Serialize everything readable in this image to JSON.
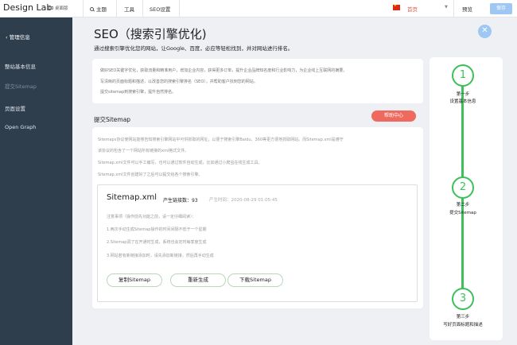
{
  "topbar": {
    "logo": "Design Lab",
    "logo_sub": "桌面版",
    "nav": [
      {
        "label": "主题",
        "icon": "search-icon"
      },
      {
        "label": "工具"
      },
      {
        "label": "SEO设置"
      }
    ],
    "page_select": "首页",
    "preview": "预览",
    "save": "保存"
  },
  "sidebar": {
    "back_label": "管理信息",
    "items": [
      {
        "label": "整站基本信息",
        "active": false
      },
      {
        "label": "提交Sitemap",
        "active": true
      },
      {
        "label": "页面设置",
        "active": false
      },
      {
        "label": "Open Graph",
        "active": false
      }
    ]
  },
  "main": {
    "title": "SEO（搜索引擎优化)",
    "subtitle": "通过搜索引擎优化您的网站，让Google、百度，必应等轻松找到，并对网站进行排名。",
    "intro": [
      "做好SEO关键字优化，获取流量和精准用户，增加企业内容，获得更多订单，提升企业品牌知名度和行业影响力，为企业线上互联网的摘要。",
      "写清晰的页面标题和描述，以改善您的搜索引擎排名（SEO），并帮助客户找到您的网站。",
      "提交sitemap到搜索引擎，提升自然排名。"
    ],
    "section_title": "提交Sitemap",
    "help_button": "帮助中心",
    "desc": [
      "Sitemaps协议使网站能够告知搜索引擎网站中可供抓取的网址，以便于搜索引擎Baidu、360等更方便地抓取网站。而Sitemap.xml是遵守",
      "该协议的包含了一个网站所有链接的xml格式文件。",
      "Sitemap.xml文件可以手工编写，也可以通过软件自动生成，比如通过小爬虫在线生成工具。",
      "Sitemap.xml文件创建好了之后可以提交给各个搜索引擎。"
    ],
    "sitemap": {
      "file": "Sitemap.xml",
      "count_label": "产生链接数：93",
      "time_label": "产生时间：2020-08-29 01:05:45",
      "notes": [
        "注意事项（操作前先功能之前，请一定仔细阅读）：",
        "1.两次手动生成Sitemap操作的时间间隔不低于一个星期",
        "2.Sitemap调了在开通时生成，系统也会定时每季度生成",
        "3.网站若有新链接添加时，请先添加新链接，然后再手动生成"
      ],
      "buttons": [
        "复制Sitemap",
        "重新生成",
        "下载Sitemap"
      ]
    }
  },
  "steps": [
    {
      "num": "1",
      "label1": "第一步",
      "label2": "设置基本信息"
    },
    {
      "num": "2",
      "label1": "第二步",
      "label2": "提交Sitemap"
    },
    {
      "num": "3",
      "label1": "第三步",
      "label2": "写好页面标题和描述"
    }
  ],
  "colors": {
    "sidebar_bg": "#2f3e4d",
    "accent_blue": "#9ec7f4",
    "step_green": "#3cc05a",
    "help_red": "#ee6a5e"
  }
}
